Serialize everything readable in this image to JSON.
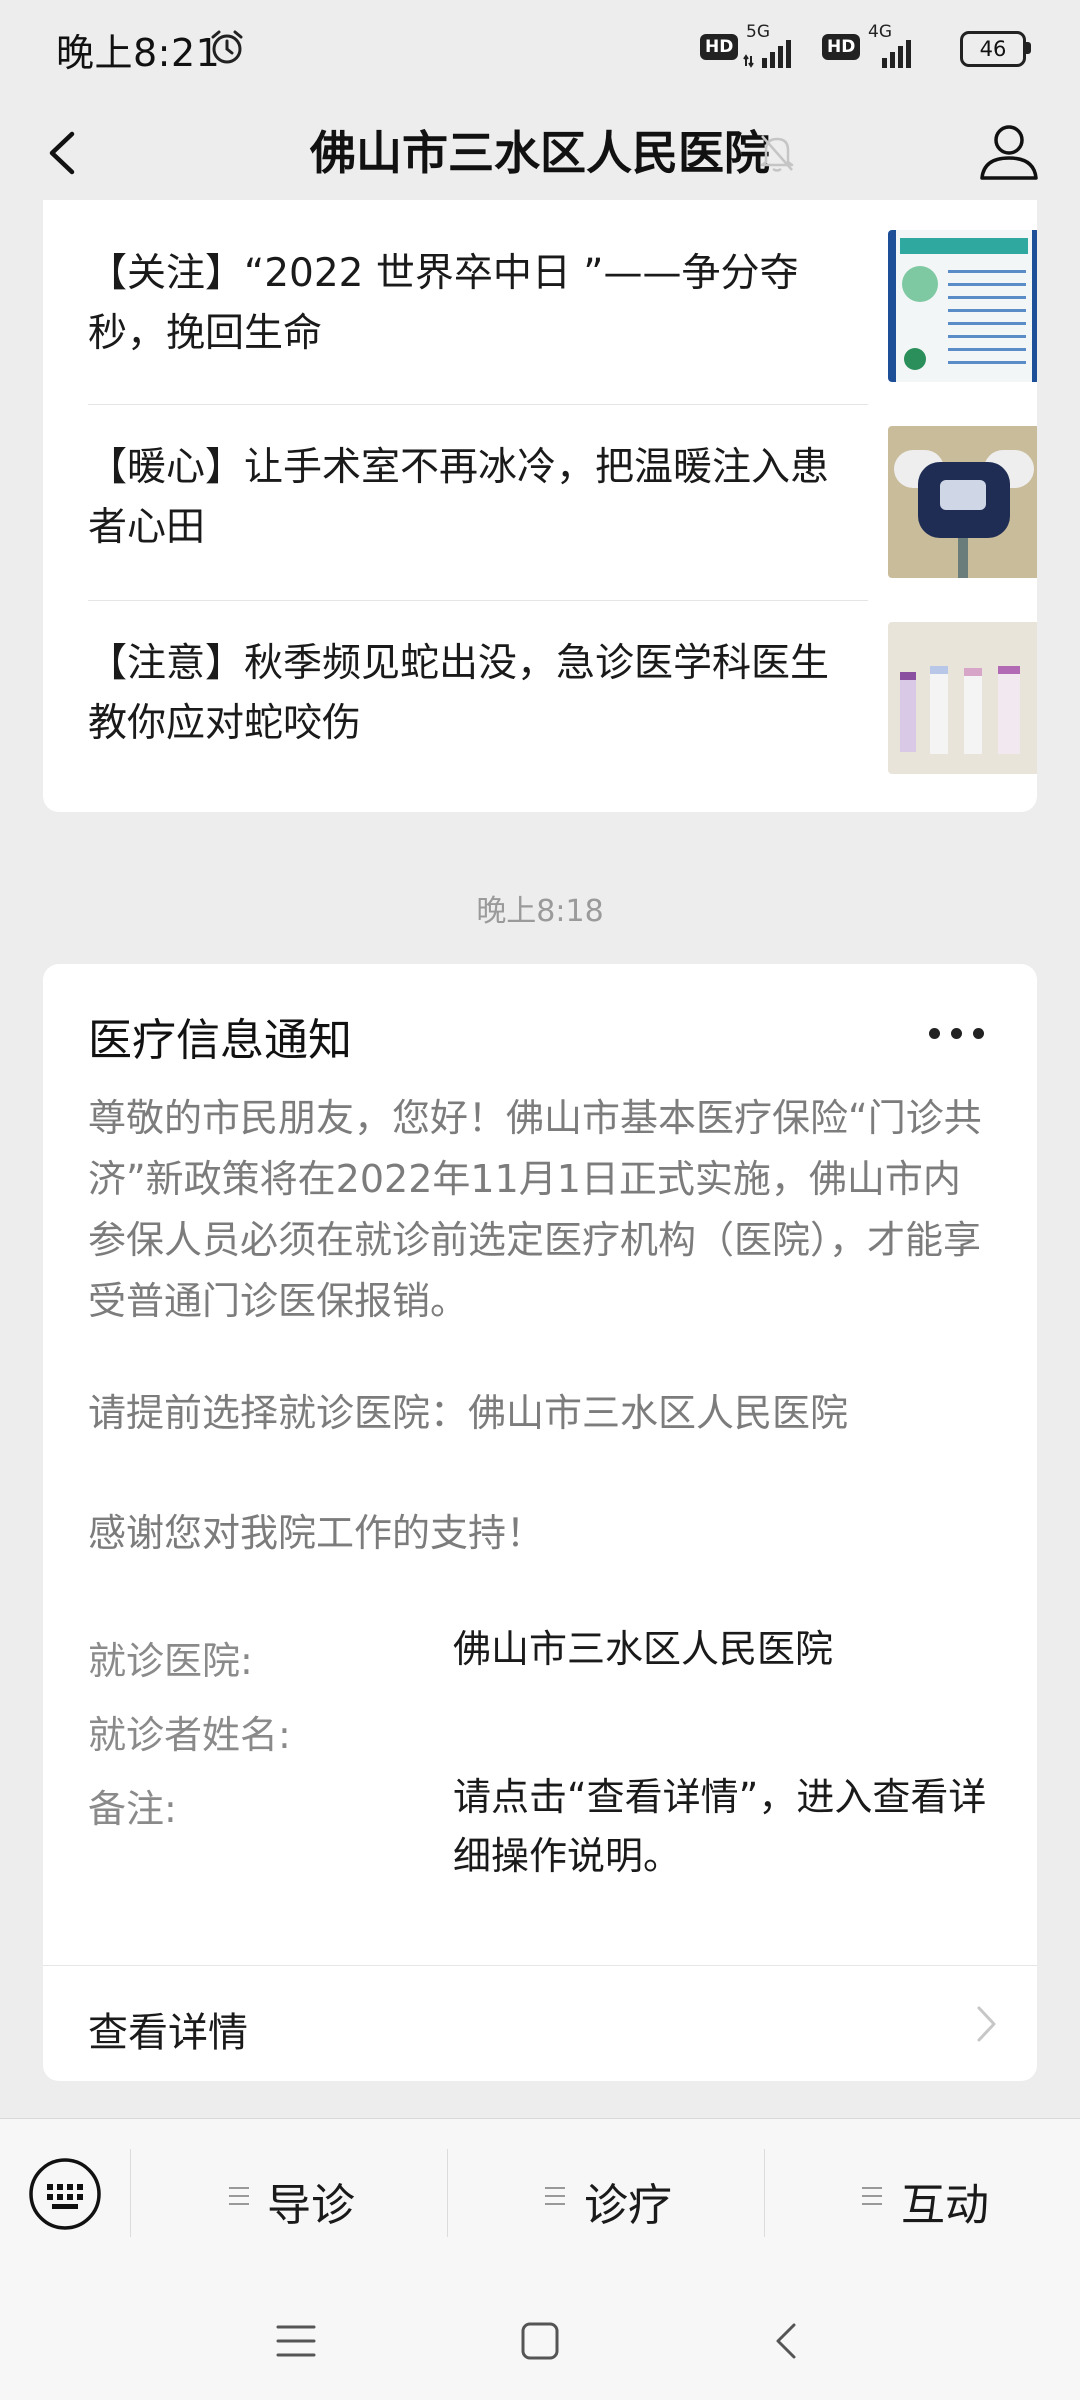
{
  "status_bar": {
    "time": "晚上8:21",
    "alarm_icon": "alarm-clock-icon",
    "hd_badge": "HD",
    "network_5g": "5G",
    "network_4g": "4G",
    "battery": "46"
  },
  "nav": {
    "title": "佛山市三水区人民医院",
    "back_icon": "chevron-left-icon",
    "mute_icon": "bell-off-icon",
    "profile_icon": "person-icon"
  },
  "articles": [
    {
      "title": "【关注】“2022 世界卒中日 ”——争分夺秒，挽回生命"
    },
    {
      "title": "【暖心】让手术室不再冰冷，把温暖注入患者心田"
    },
    {
      "title": "【注意】秋季频见蛇出没，急诊医学科医生教你应对蛇咬伤"
    }
  ],
  "timestamp": "晚上8:18",
  "notice": {
    "title": "医疗信息通知",
    "body": "尊敬的市民朋友，您好！佛山市基本医疗保险“门诊共济”新政策将在2022年11月1日正式实施，佛山市内参保人员必须在就诊前选定医疗机构（医院），才能享受普通门诊医保报销。",
    "line2": "请提前选择就诊医院：佛山市三水区人民医院",
    "line3": "感谢您对我院工作的支持！",
    "fields": [
      {
        "label": "就诊医院:",
        "value": "佛山市三水区人民医院"
      },
      {
        "label": "就诊者姓名:",
        "value": ""
      },
      {
        "label": "备注:",
        "value": "请点击“查看详情”，进入查看详细操作说明。"
      }
    ],
    "details_label": "查看详情"
  },
  "bottom_menu": {
    "items": [
      {
        "label": "导诊"
      },
      {
        "label": "诊疗"
      },
      {
        "label": "互动"
      }
    ]
  }
}
